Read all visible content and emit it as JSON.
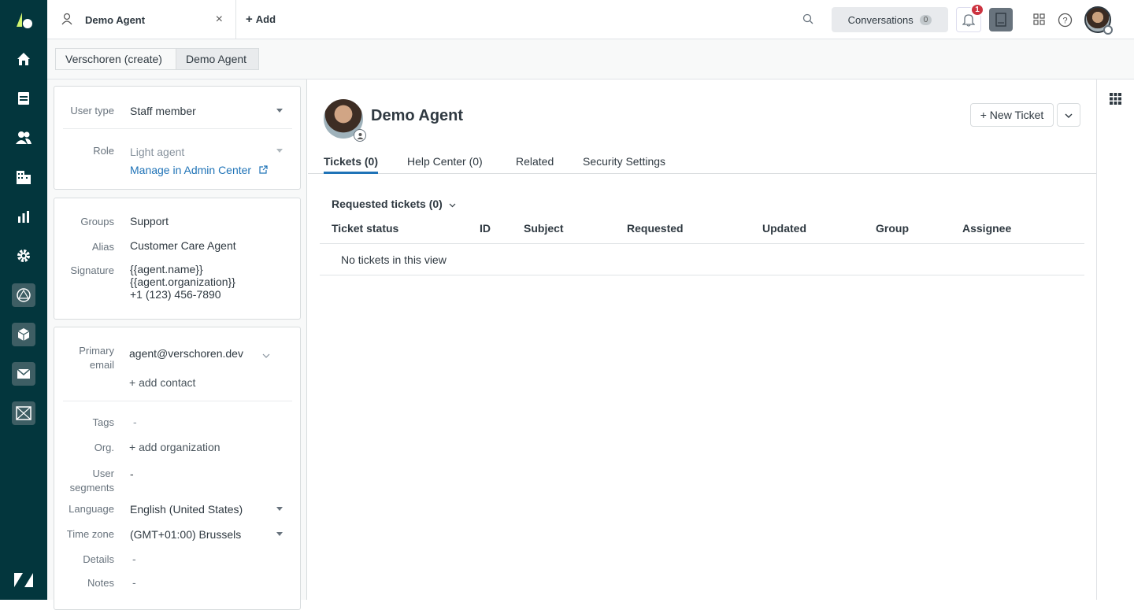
{
  "topbar": {
    "tab_title": "Demo Agent",
    "add_label": "Add",
    "conversations_label": "Conversations",
    "conversations_count": "0",
    "notifications_count": "1"
  },
  "breadcrumbs": [
    "Verschoren (create)",
    "Demo Agent"
  ],
  "user_card": {
    "user_type_label": "User type",
    "user_type_value": "Staff member",
    "role_label": "Role",
    "role_value": "Light agent",
    "manage_link": "Manage in Admin Center"
  },
  "groups_card": {
    "groups_label": "Groups",
    "groups_value": "Support",
    "alias_label": "Alias",
    "alias_value": "Customer Care Agent",
    "signature_label": "Signature",
    "signature_lines": [
      "{{agent.name}}",
      "{{agent.organization}}",
      "+1 (123) 456-7890"
    ]
  },
  "contact_card": {
    "primary_label_1": "Primary",
    "primary_label_2": "email",
    "primary_email": "agent@verschoren.dev",
    "add_contact": "+ add contact",
    "tags_label": "Tags",
    "tags_value": "-",
    "org_label": "Org.",
    "org_value": "+ add organization",
    "segments_label_1": "User",
    "segments_label_2": "segments",
    "segments_value": "-",
    "language_label": "Language",
    "language_value": "English (United States)",
    "timezone_label": "Time zone",
    "timezone_value": "(GMT+01:00) Brussels",
    "details_label": "Details",
    "details_value": "-",
    "notes_label": "Notes",
    "notes_value": "-"
  },
  "profile": {
    "name": "Demo Agent",
    "new_ticket": "+ New Ticket",
    "tabs": [
      "Tickets (0)",
      "Help Center (0)",
      "Related",
      "Security Settings"
    ],
    "requested_header": "Requested tickets (0)",
    "columns": [
      "Ticket status",
      "ID",
      "Subject",
      "Requested",
      "Updated",
      "Group",
      "Assignee"
    ],
    "empty_message": "No tickets in this view"
  },
  "icons": {
    "rail": [
      "zendesk-logo-icon",
      "home-icon",
      "views-icon",
      "customers-icon",
      "organizations-icon",
      "reporting-icon",
      "admin-gear-icon",
      "explore-icon",
      "product-box-icon",
      "mail-icon",
      "sell-icon",
      "zendesk-z-icon"
    ]
  }
}
